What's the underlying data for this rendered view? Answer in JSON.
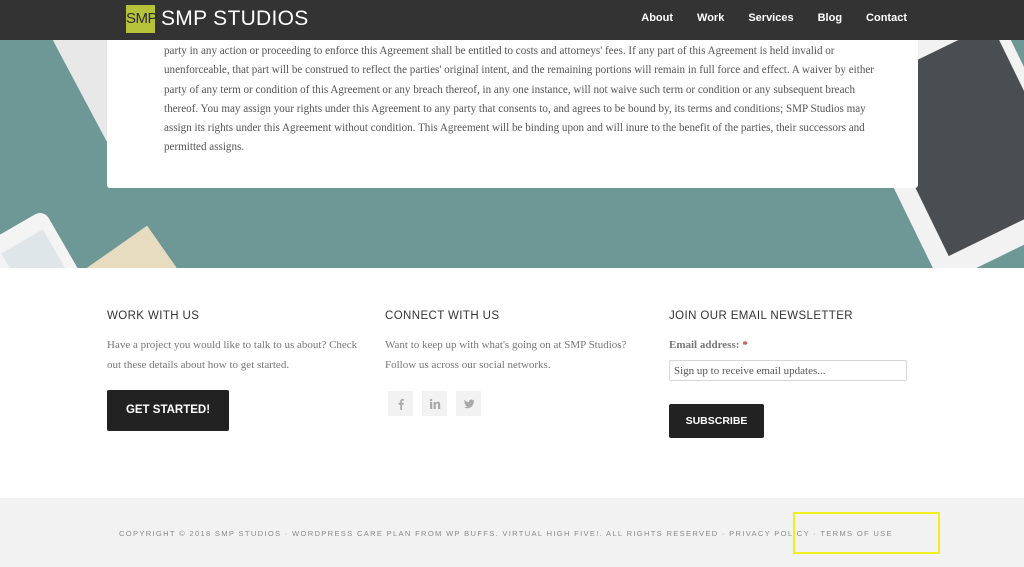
{
  "header": {
    "logo_mark": "SMP",
    "logo_text": "SMP STUDIOS",
    "nav": [
      "About",
      "Work",
      "Services",
      "Blog",
      "Contact"
    ]
  },
  "agreement": {
    "text": "party in any action or proceeding to enforce this Agreement shall be entitled to costs and attorneys' fees. If any part of this Agreement is held invalid or unenforceable, that part will be construed to reflect the parties' original intent, and the remaining portions will remain in full force and effect. A waiver by either party of any term or condition of this Agreement or any breach thereof, in any one instance, will not waive such term or condition or any subsequent breach thereof. You may assign your rights under this Agreement to any party that consents to, and agrees to be bound by, its terms and conditions; SMP Studios may assign its rights under this Agreement without condition. This Agreement will be binding upon and will inure to the benefit of the parties, their successors and permitted assigns."
  },
  "footer": {
    "work": {
      "title": "WORK WITH US",
      "text": "Have a project you would like to talk to us about? Check out these details about how to get started.",
      "button": "GET STARTED!"
    },
    "connect": {
      "title": "CONNECT WITH US",
      "text": "Want to keep up with what's going on at SMP Studios? Follow us across our social networks.",
      "icons": [
        "facebook-icon",
        "linkedin-icon",
        "twitter-icon"
      ]
    },
    "newsletter": {
      "title": "JOIN OUR EMAIL NEWSLETTER",
      "label": "Email address:",
      "required_mark": "*",
      "placeholder": "Sign up to receive email updates...",
      "button": "SUBSCRIBE"
    }
  },
  "bottom": {
    "copyright": "COPYRIGHT © 2018 SMP STUDIOS · WORDPRESS CARE PLAN FROM WP BUFFS. VIRTUAL HIGH FIVE!. ALL RIGHTS RESERVED · ",
    "privacy": "PRIVACY POLICY",
    "separator": " · ",
    "terms": "TERMS OF USE"
  },
  "colors": {
    "header_bg": "#333333",
    "logo_accent": "#b6c23a",
    "hero_teal": "#6e9896",
    "button_dark": "#222222",
    "highlight": "#f2ee1e"
  }
}
